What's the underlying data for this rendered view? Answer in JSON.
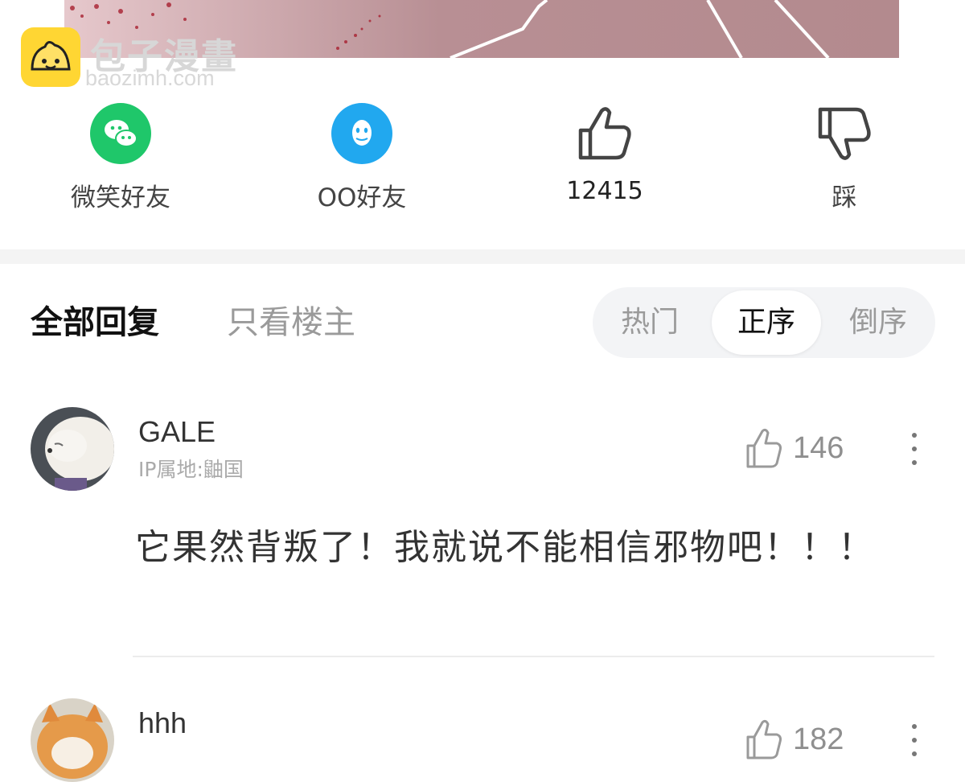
{
  "watermark": {
    "brand_cn": "包子漫畫",
    "brand_en": "baozimh.com"
  },
  "share": [
    {
      "icon": "wechat-icon",
      "label": "微笑好友",
      "color": "#1fc76a"
    },
    {
      "icon": "qq-icon",
      "label": "OO好友",
      "color": "#21a8ef"
    },
    {
      "icon": "thumbs-up-icon",
      "label": "12415"
    },
    {
      "icon": "thumbs-down-icon",
      "label": "踩"
    }
  ],
  "tabs": {
    "all": "全部回复",
    "owner_only": "只看楼主"
  },
  "sort": {
    "options": [
      "热门",
      "正序",
      "倒序"
    ],
    "active": "正序"
  },
  "comments": [
    {
      "user": "GALE",
      "ip": "IP属地:鼬国",
      "likes": "146",
      "text": "它果然背叛了！我就说不能相信邪物吧！！！"
    },
    {
      "user": "hhh",
      "likes": "182"
    }
  ]
}
